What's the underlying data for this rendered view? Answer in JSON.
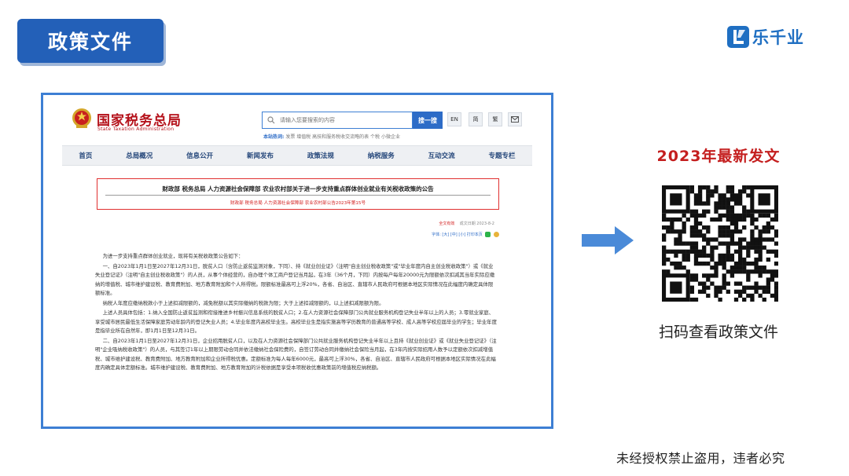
{
  "header": {
    "title": "政策文件",
    "brand": {
      "name": "乐千业",
      "color": "#1f6fc2"
    }
  },
  "screenshot": {
    "site": {
      "name": "国家税务总局",
      "name_en": "State Taxation Administration",
      "search_placeholder": "请输入您要搜索的内容",
      "search_button": "搜一搜",
      "lang_buttons": [
        "EN",
        "简",
        "繁"
      ],
      "hot_label": "本站热词:",
      "hot_words": "发票  增值税  高技和服务税收交流略的表  个税  小微企业"
    },
    "nav": [
      "首页",
      "总局概况",
      "信息公开",
      "新闻发布",
      "政策法规",
      "纳税服务",
      "互动交流",
      "专题专栏"
    ],
    "notice": {
      "title": "财政部  税务总局  人力资源社会保障部  农业农村部关于进一步支持重点群体创业就业有关税收政策的公告",
      "subtitle": "财政部  税务总局  人力资源社会保障部  农业农村部公告2023年第15号"
    },
    "meta": {
      "validity": "全文有效",
      "date": "成文日期 2023-8-2"
    },
    "tools": "字体:  [大]  [中]  [小]  打印本页",
    "article": [
      "为进一步支持重点群体创业就业，现将有关税收政策公告如下：",
      "一、自2023年1月1日至2027年12月31日，脱贫人口（含防止返贫监测对象，下同）、持《就业创业证》（注明\"自主创业税收政策\"或\"毕业年度内自主创业税收政策\"）或《就业失业登记证》（注明\"自主创业税收政策\"）的人员，从事个体经营的，自办理个体工商户登记当月起，在3年（36个月，下同）内按每户每年20000元为限额依次扣减其当年实际应缴纳的增值税、城市维护建设税、教育费附加、地方教育附加和个人所得税。限额标准最高可上浮20%，各省、自治区、直辖市人民政府可根据本地区实际情况在此幅度内确定具体限额标准。",
      "纳税人年度应缴纳税款小于上述扣减限额的，减免税额以其实际缴纳的税款为限；大于上述扣减限额的，以上述扣减限额为限。",
      "上述人员具体包括：1.纳入全国防止返贫监测和衔接推进乡村振兴信息系统的脱贫人口；2.在人力资源社会保障部门公共就业服务机构登记失业半年以上的人员；3.零就业家庭、享受城市居民最低生活保障家庭劳动年龄内的登记失业人员；4.毕业年度内高校毕业生。高校毕业生是指实施高等学历教育的普通高等学校、成人高等学校应届毕业的学生；毕业年度是指毕业所在自然年，即1月1日至12月31日。",
      "二、自2023年1月1日至2027年12月31日，企业招用脱贫人口，以及在人力资源社会保障部门公共就业服务机构登记失业半年以上且持《就业创业证》或《就业失业登记证》（注明\"企业吸纳税收政策\"）的人员，与其签订1年以上期限劳动合同并依法缴纳社会保险费的，自签订劳动合同并缴纳社会保险当月起，在3年内按实际招用人数予以定额依次扣减增值税、城市维护建设税、教育费附加、地方教育附加和企业所得税优惠。定额标准为每人每年6000元，最高可上浮30%，各省、自治区、直辖市人民政府可根据本地区实际情况在此幅度内确定具体定额标准。城市维护建设税、教育费附加、地方教育附加的计税依据是享受本项税收优惠政策前的增值税应纳税额。"
    ]
  },
  "right": {
    "latest_label": "2023年最新发文",
    "scan_tip": "扫码查看政策文件"
  },
  "footer": {
    "copyright": "未经授权禁止盗用，违者必究"
  },
  "colors": {
    "title_bg": "#2360b8",
    "frame_border": "#3d7fd4",
    "accent_red": "#c41e1e",
    "arrow": "#4a8ad8"
  }
}
